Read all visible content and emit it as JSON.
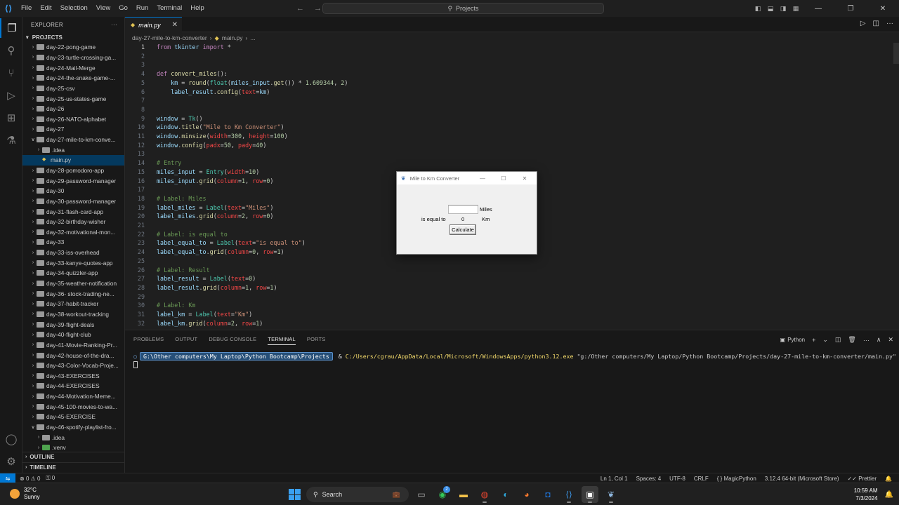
{
  "menu": [
    "File",
    "Edit",
    "Selection",
    "View",
    "Go",
    "Run",
    "Terminal",
    "Help"
  ],
  "command_center": "Projects",
  "explorer": {
    "title": "EXPLORER",
    "section": "PROJECTS",
    "items": [
      {
        "label": "day-22-pong-game",
        "type": "folder",
        "open": false,
        "indent": 1
      },
      {
        "label": "day-23-turtle-crossing-ga...",
        "type": "folder",
        "open": false,
        "indent": 1
      },
      {
        "label": "day-24-Mail-Merge",
        "type": "folder",
        "open": false,
        "indent": 1
      },
      {
        "label": "day-24-the-snake-game-...",
        "type": "folder",
        "open": false,
        "indent": 1
      },
      {
        "label": "day-25-csv",
        "type": "folder",
        "open": false,
        "indent": 1
      },
      {
        "label": "day-25-us-states-game",
        "type": "folder",
        "open": false,
        "indent": 1
      },
      {
        "label": "day-26",
        "type": "folder",
        "open": false,
        "indent": 1
      },
      {
        "label": "day-26-NATO-alphabet",
        "type": "folder",
        "open": false,
        "indent": 1
      },
      {
        "label": "day-27",
        "type": "folder",
        "open": false,
        "indent": 1
      },
      {
        "label": "day-27-mile-to-km-conve...",
        "type": "folder",
        "open": true,
        "indent": 1
      },
      {
        "label": ".idea",
        "type": "folder",
        "open": false,
        "indent": 2
      },
      {
        "label": "main.py",
        "type": "file",
        "open": false,
        "indent": 2,
        "selected": true
      },
      {
        "label": "day-28-pomodoro-app",
        "type": "folder",
        "open": false,
        "indent": 1
      },
      {
        "label": "day-29-password-manager",
        "type": "folder",
        "open": false,
        "indent": 1
      },
      {
        "label": "day-30",
        "type": "folder",
        "open": false,
        "indent": 1
      },
      {
        "label": "day-30-password-manager",
        "type": "folder",
        "open": false,
        "indent": 1
      },
      {
        "label": "day-31-flash-card-app",
        "type": "folder",
        "open": false,
        "indent": 1
      },
      {
        "label": "day-32-birthday-wisher",
        "type": "folder",
        "open": false,
        "indent": 1
      },
      {
        "label": "day-32-motivational-mon...",
        "type": "folder",
        "open": false,
        "indent": 1
      },
      {
        "label": "day-33",
        "type": "folder",
        "open": false,
        "indent": 1
      },
      {
        "label": "day-33-iss-overhead",
        "type": "folder",
        "open": false,
        "indent": 1
      },
      {
        "label": "day-33-kanye-quotes-app",
        "type": "folder",
        "open": false,
        "indent": 1
      },
      {
        "label": "day-34-quizzler-app",
        "type": "folder",
        "open": false,
        "indent": 1
      },
      {
        "label": "day-35-weather-notification",
        "type": "folder",
        "open": false,
        "indent": 1
      },
      {
        "label": "day-36- stock-trading-ne...",
        "type": "folder",
        "open": false,
        "indent": 1
      },
      {
        "label": "day-37-habit-tracker",
        "type": "folder",
        "open": false,
        "indent": 1
      },
      {
        "label": "day-38-workout-tracking",
        "type": "folder",
        "open": false,
        "indent": 1
      },
      {
        "label": "day-39-flight-deals",
        "type": "folder",
        "open": false,
        "indent": 1
      },
      {
        "label": "day-40-flight-club",
        "type": "folder",
        "open": false,
        "indent": 1
      },
      {
        "label": "day-41-Movie-Ranking-Pr...",
        "type": "folder",
        "open": false,
        "indent": 1
      },
      {
        "label": "day-42-house-of-the-dra...",
        "type": "folder",
        "open": false,
        "indent": 1
      },
      {
        "label": "day-43-Color-Vocab-Proje...",
        "type": "folder",
        "open": false,
        "indent": 1
      },
      {
        "label": "day-43-EXERCISES",
        "type": "folder",
        "open": false,
        "indent": 1
      },
      {
        "label": "day-44-EXERCISES",
        "type": "folder",
        "open": false,
        "indent": 1
      },
      {
        "label": "day-44-Motivation-Meme...",
        "type": "folder",
        "open": false,
        "indent": 1
      },
      {
        "label": "day-45-100-movies-to-wa...",
        "type": "folder",
        "open": false,
        "indent": 1
      },
      {
        "label": "day-45-EXERCISE",
        "type": "folder",
        "open": false,
        "indent": 1
      },
      {
        "label": "day-46-spotify-playlist-fro...",
        "type": "folder",
        "open": true,
        "indent": 1
      },
      {
        "label": ".idea",
        "type": "folder",
        "open": false,
        "indent": 2
      },
      {
        "label": ".venv",
        "type": "folder",
        "open": false,
        "indent": 2,
        "green": true
      }
    ],
    "outline": "OUTLINE",
    "timeline": "TIMELINE"
  },
  "editor": {
    "tab_label": "main.py",
    "breadcrumb": [
      "day-27-mile-to-km-converter",
      "main.py",
      "..."
    ]
  },
  "code_lines": [
    [
      [
        "kw",
        "from"
      ],
      [
        "pr",
        " "
      ],
      [
        "nm",
        "tkinter"
      ],
      [
        "pr",
        " "
      ],
      [
        "kw",
        "import"
      ],
      [
        "pr",
        " *"
      ]
    ],
    [],
    [],
    [
      [
        "kw",
        "def"
      ],
      [
        "pr",
        " "
      ],
      [
        "fn",
        "convert_miles"
      ],
      [
        "pr",
        "():"
      ]
    ],
    [
      [
        "pr",
        "    "
      ],
      [
        "nm",
        "km"
      ],
      [
        "pr",
        " = "
      ],
      [
        "fn",
        "round"
      ],
      [
        "pr",
        "("
      ],
      [
        "bi",
        "float"
      ],
      [
        "pr",
        "("
      ],
      [
        "nm",
        "miles_input"
      ],
      [
        "pr",
        "."
      ],
      [
        "fn",
        "get"
      ],
      [
        "pr",
        "()) * "
      ],
      [
        "num",
        "1.609344"
      ],
      [
        "pr",
        ", "
      ],
      [
        "num",
        "2"
      ],
      [
        "pr",
        ")"
      ]
    ],
    [
      [
        "pr",
        "    "
      ],
      [
        "nm",
        "label_result"
      ],
      [
        "pr",
        "."
      ],
      [
        "fn",
        "config"
      ],
      [
        "pr",
        "("
      ],
      [
        "par",
        "text"
      ],
      [
        "pr",
        "="
      ],
      [
        "nm",
        "km"
      ],
      [
        "pr",
        ")"
      ]
    ],
    [],
    [],
    [
      [
        "nm",
        "window"
      ],
      [
        "pr",
        " = "
      ],
      [
        "bi",
        "Tk"
      ],
      [
        "pr",
        "()"
      ]
    ],
    [
      [
        "nm",
        "window"
      ],
      [
        "pr",
        "."
      ],
      [
        "fn",
        "title"
      ],
      [
        "pr",
        "("
      ],
      [
        "st",
        "\"Mile to Km Converter\""
      ],
      [
        "pr",
        ")"
      ]
    ],
    [
      [
        "nm",
        "window"
      ],
      [
        "pr",
        "."
      ],
      [
        "fn",
        "minsize"
      ],
      [
        "pr",
        "("
      ],
      [
        "par",
        "width"
      ],
      [
        "pr",
        "="
      ],
      [
        "num",
        "300"
      ],
      [
        "pr",
        ", "
      ],
      [
        "par",
        "height"
      ],
      [
        "pr",
        "="
      ],
      [
        "num",
        "100"
      ],
      [
        "pr",
        ")"
      ]
    ],
    [
      [
        "nm",
        "window"
      ],
      [
        "pr",
        "."
      ],
      [
        "fn",
        "config"
      ],
      [
        "pr",
        "("
      ],
      [
        "par",
        "padx"
      ],
      [
        "pr",
        "="
      ],
      [
        "num",
        "50"
      ],
      [
        "pr",
        ", "
      ],
      [
        "par",
        "pady"
      ],
      [
        "pr",
        "="
      ],
      [
        "num",
        "40"
      ],
      [
        "pr",
        ")"
      ]
    ],
    [],
    [
      [
        "cm",
        "# Entry"
      ]
    ],
    [
      [
        "nm",
        "miles_input"
      ],
      [
        "pr",
        " = "
      ],
      [
        "bi",
        "Entry"
      ],
      [
        "pr",
        "("
      ],
      [
        "par",
        "width"
      ],
      [
        "pr",
        "="
      ],
      [
        "num",
        "10"
      ],
      [
        "pr",
        ")"
      ]
    ],
    [
      [
        "nm",
        "miles_input"
      ],
      [
        "pr",
        "."
      ],
      [
        "fn",
        "grid"
      ],
      [
        "pr",
        "("
      ],
      [
        "par",
        "column"
      ],
      [
        "pr",
        "="
      ],
      [
        "num",
        "1"
      ],
      [
        "pr",
        ", "
      ],
      [
        "par",
        "row"
      ],
      [
        "pr",
        "="
      ],
      [
        "num",
        "0"
      ],
      [
        "pr",
        ")"
      ]
    ],
    [],
    [
      [
        "cm",
        "# Label: Miles"
      ]
    ],
    [
      [
        "nm",
        "label_miles"
      ],
      [
        "pr",
        " = "
      ],
      [
        "bi",
        "Label"
      ],
      [
        "pr",
        "("
      ],
      [
        "par",
        "text"
      ],
      [
        "pr",
        "="
      ],
      [
        "st",
        "\"Miles\""
      ],
      [
        "pr",
        ")"
      ]
    ],
    [
      [
        "nm",
        "label_miles"
      ],
      [
        "pr",
        "."
      ],
      [
        "fn",
        "grid"
      ],
      [
        "pr",
        "("
      ],
      [
        "par",
        "column"
      ],
      [
        "pr",
        "="
      ],
      [
        "num",
        "2"
      ],
      [
        "pr",
        ", "
      ],
      [
        "par",
        "row"
      ],
      [
        "pr",
        "="
      ],
      [
        "num",
        "0"
      ],
      [
        "pr",
        ")"
      ]
    ],
    [],
    [
      [
        "cm",
        "# Label: is equal to"
      ]
    ],
    [
      [
        "nm",
        "label_equal_to"
      ],
      [
        "pr",
        " = "
      ],
      [
        "bi",
        "Label"
      ],
      [
        "pr",
        "("
      ],
      [
        "par",
        "text"
      ],
      [
        "pr",
        "="
      ],
      [
        "st",
        "\"is equal to\""
      ],
      [
        "pr",
        ")"
      ]
    ],
    [
      [
        "nm",
        "label_equal_to"
      ],
      [
        "pr",
        "."
      ],
      [
        "fn",
        "grid"
      ],
      [
        "pr",
        "("
      ],
      [
        "par",
        "column"
      ],
      [
        "pr",
        "="
      ],
      [
        "num",
        "0"
      ],
      [
        "pr",
        ", "
      ],
      [
        "par",
        "row"
      ],
      [
        "pr",
        "="
      ],
      [
        "num",
        "1"
      ],
      [
        "pr",
        ")"
      ]
    ],
    [],
    [
      [
        "cm",
        "# Label: Result"
      ]
    ],
    [
      [
        "nm",
        "label_result"
      ],
      [
        "pr",
        " = "
      ],
      [
        "bi",
        "Label"
      ],
      [
        "pr",
        "("
      ],
      [
        "par",
        "text"
      ],
      [
        "pr",
        "="
      ],
      [
        "num",
        "0"
      ],
      [
        "pr",
        ")"
      ]
    ],
    [
      [
        "nm",
        "label_result"
      ],
      [
        "pr",
        "."
      ],
      [
        "fn",
        "grid"
      ],
      [
        "pr",
        "("
      ],
      [
        "par",
        "column"
      ],
      [
        "pr",
        "="
      ],
      [
        "num",
        "1"
      ],
      [
        "pr",
        ", "
      ],
      [
        "par",
        "row"
      ],
      [
        "pr",
        "="
      ],
      [
        "num",
        "1"
      ],
      [
        "pr",
        ")"
      ]
    ],
    [],
    [
      [
        "cm",
        "# Label: Km"
      ]
    ],
    [
      [
        "nm",
        "label_km"
      ],
      [
        "pr",
        " = "
      ],
      [
        "bi",
        "Label"
      ],
      [
        "pr",
        "("
      ],
      [
        "par",
        "text"
      ],
      [
        "pr",
        "="
      ],
      [
        "st",
        "\"Km\""
      ],
      [
        "pr",
        ")"
      ]
    ],
    [
      [
        "nm",
        "label_km"
      ],
      [
        "pr",
        "."
      ],
      [
        "fn",
        "grid"
      ],
      [
        "pr",
        "("
      ],
      [
        "par",
        "column"
      ],
      [
        "pr",
        "="
      ],
      [
        "num",
        "2"
      ],
      [
        "pr",
        ", "
      ],
      [
        "par",
        "row"
      ],
      [
        "pr",
        "="
      ],
      [
        "num",
        "1"
      ],
      [
        "pr",
        ")"
      ]
    ]
  ],
  "panel": {
    "tabs": [
      "PROBLEMS",
      "OUTPUT",
      "DEBUG CONSOLE",
      "TERMINAL",
      "PORTS"
    ],
    "active_tab": "TERMINAL",
    "shell_label": "Python",
    "prompt_path": "G:\\Other computers\\My Laptop\\Python Bootcamp\\Projects",
    "command_amp": "&",
    "command_exe": "C:/Users/cgrau/AppData/Local/Microsoft/WindowsApps/python3.12.exe",
    "command_arg": "\"g:/Other computers/My Laptop/Python Bootcamp/Projects/day-27-mile-to-km-converter/main.py\""
  },
  "statusbar": {
    "errors": "0",
    "warnings": "0",
    "ports": "0",
    "position": "Ln 1, Col 1",
    "spaces": "Spaces: 4",
    "encoding": "UTF-8",
    "eol": "CRLF",
    "magic": "MagicPython",
    "interpreter": "3.12.4 64-bit (Microsoft Store)",
    "prettier": "Prettier"
  },
  "tk_window": {
    "title": "Mile to Km Converter",
    "miles_label": "Miles",
    "equal_label": "is equal to",
    "result": "0",
    "km_label": "Km",
    "button": "Calculate",
    "entry_value": ""
  },
  "taskbar": {
    "temperature": "32°C",
    "condition": "Sunny",
    "search_placeholder": "Search",
    "whatsapp_badge": "2",
    "time": "10:59 AM",
    "date": "7/3/2024"
  },
  "colors": {
    "accent": "#0078d4",
    "editor_bg": "#1f1f1f",
    "sidebar_bg": "#181818",
    "selection": "#04395e"
  }
}
